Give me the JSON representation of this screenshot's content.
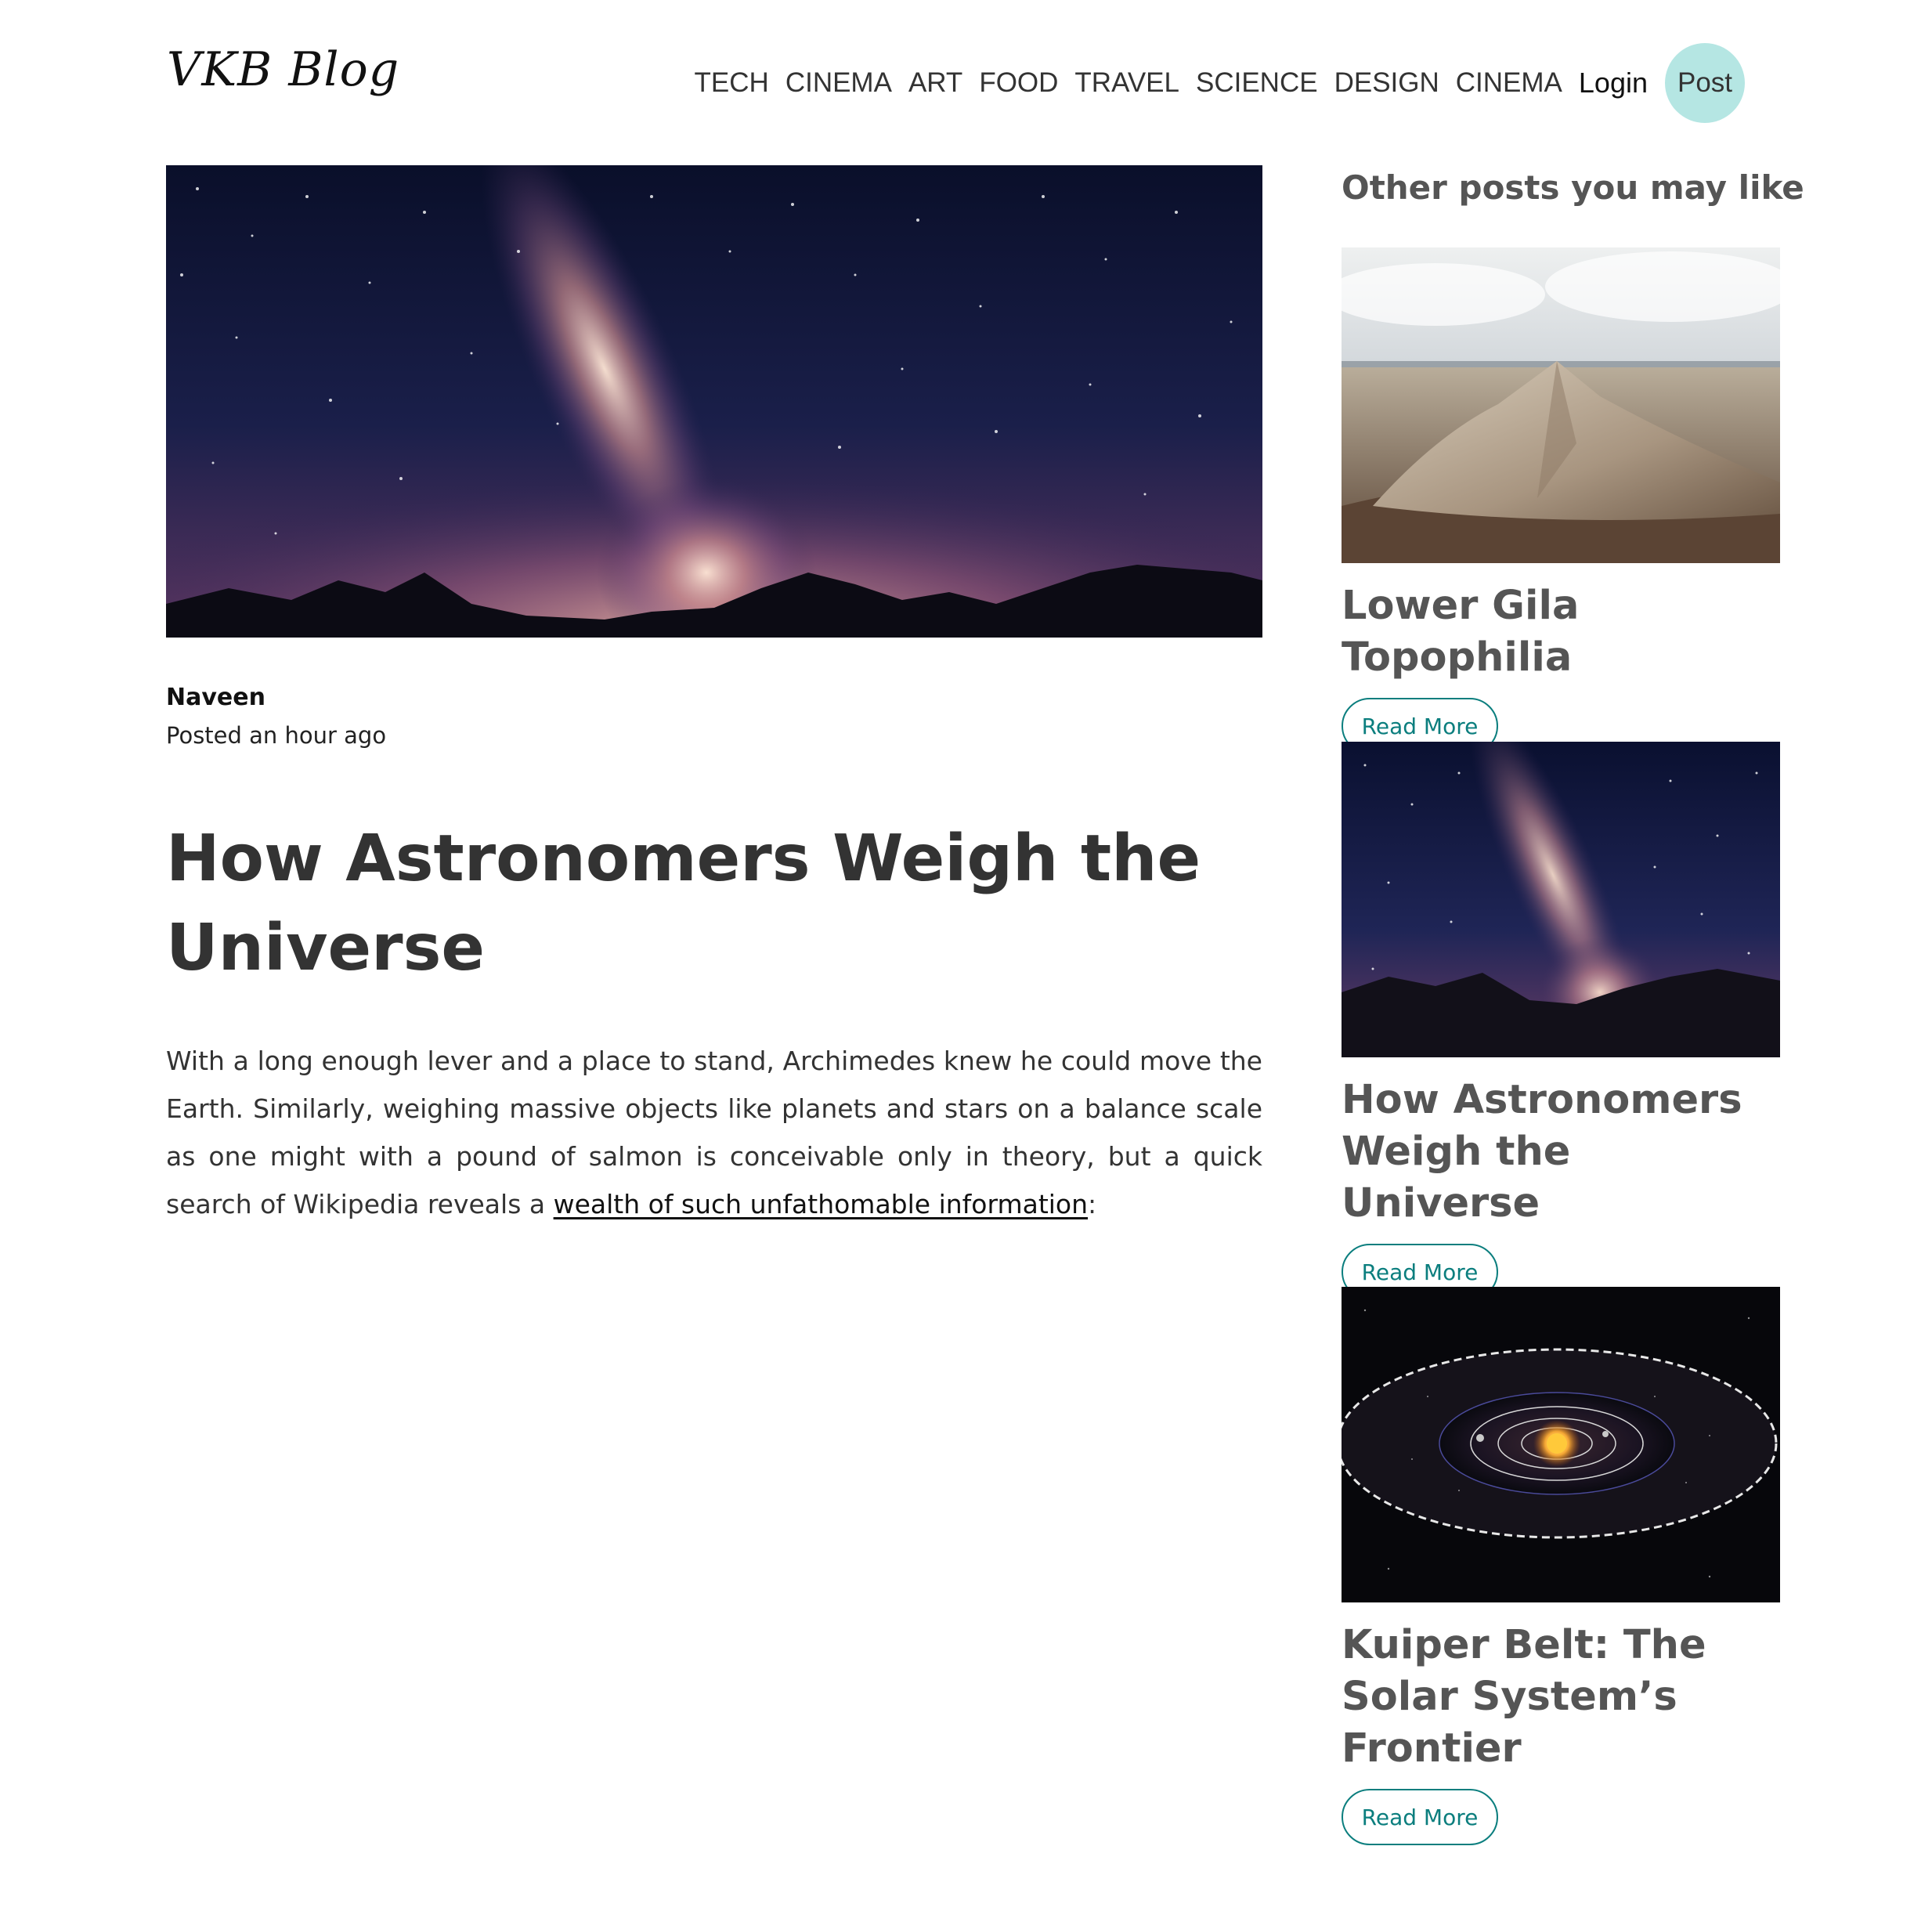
{
  "header": {
    "logo": "VKB Blog",
    "nav": [
      "TECH",
      "CINEMA",
      "ART",
      "FOOD",
      "TRAVEL",
      "SCIENCE",
      "DESIGN",
      "CINEMA"
    ],
    "login_label": "Login",
    "post_label": "Post"
  },
  "colors": {
    "accent": "#0b7e7e",
    "post_button_bg": "#b5e6e3",
    "heading_text": "#333333",
    "sidebar_text": "#555555"
  },
  "article": {
    "hero_image": "milky-way-night-sky",
    "author": "Naveen",
    "posted": "Posted an hour ago",
    "title": "How Astronomers Weigh the Universe",
    "body_text": "With a long enough lever and a place to stand, Archimedes knew he could move the Earth. Similarly, weighing massive objects like planets and stars on a balance scale as one might with a pound of salmon is conceivable only in theory, but a quick search of Wikipedia reveals a ",
    "link_text": "wealth of such unfathomable information",
    "after_link": ":"
  },
  "sidebar": {
    "heading": "Other posts you may like",
    "posts": [
      {
        "image": "mountain-aerial-photo",
        "title": "Lower Gila Topophilia",
        "button": "Read More"
      },
      {
        "image": "milky-way-night-sky",
        "title": "How Astronomers Weigh the Universe",
        "button": "Read More"
      },
      {
        "image": "solar-system-kuiper-belt",
        "title": "Kuiper Belt: The Solar System’s Frontier",
        "button": "Read More"
      }
    ]
  }
}
